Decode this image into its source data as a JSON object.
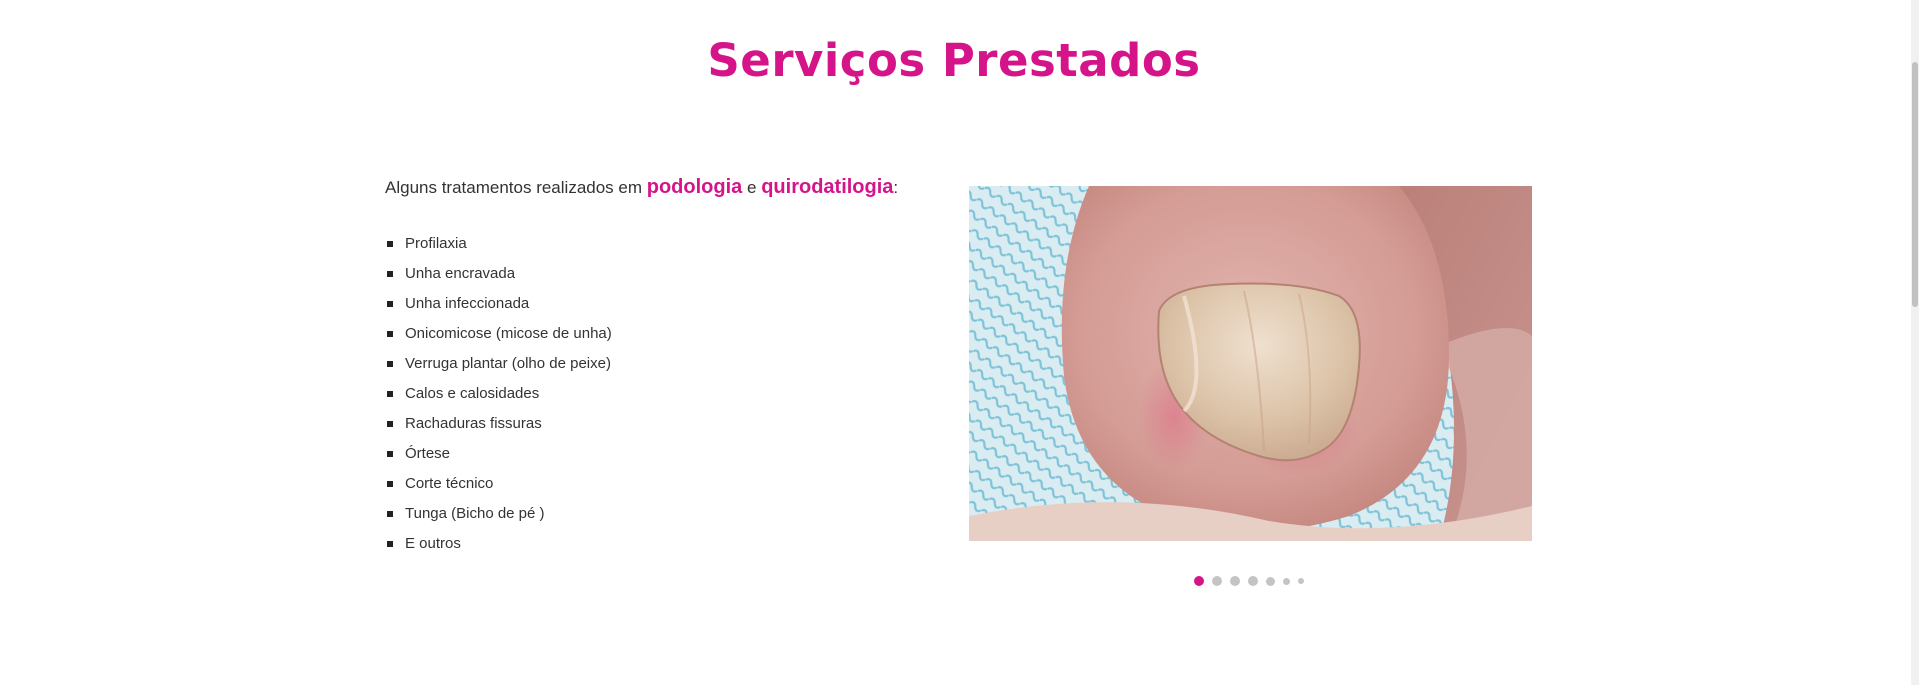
{
  "section": {
    "title": "Serviços Prestados"
  },
  "intro": {
    "text_before": "Alguns tratamentos realizados em ",
    "highlight_1": "podologia",
    "text_middle": " e ",
    "highlight_2": "quirodatilogia",
    "text_after": ":"
  },
  "services": [
    "Profilaxia",
    "Unha encravada",
    "Unha infeccionada",
    "Onicomicose (micose de unha)",
    "Verruga plantar (olho de peixe)",
    "Calos e calosidades",
    "Rachaduras fissuras",
    "Órtese",
    "Corte técnico",
    "Tunga (Bicho de pé )",
    "E outros"
  ],
  "slider": {
    "image_subject": "toenail-closeup-photo",
    "slide_count": 7,
    "active_slide": 1
  },
  "colors": {
    "accent": "#d6148a",
    "text": "#333333",
    "dot_inactive": "#c4c4c4"
  }
}
